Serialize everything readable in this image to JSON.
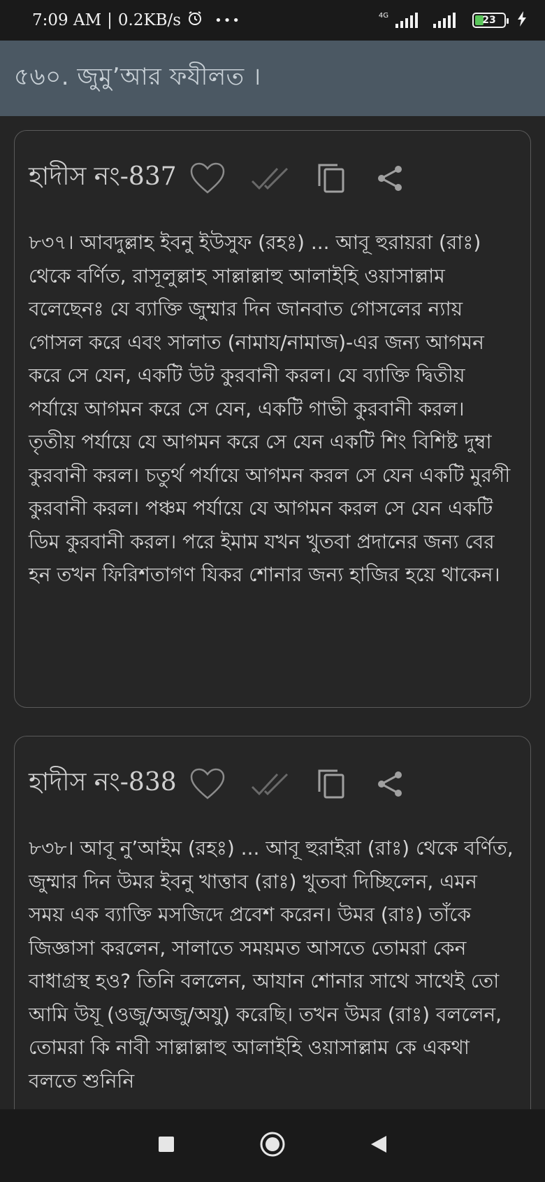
{
  "status": {
    "time": "7:09 AM",
    "speed": "0.2KB/s",
    "more": "•••",
    "network": "4G",
    "battery": "23",
    "icons": [
      "alarm-icon",
      "signal-icon",
      "battery-icon",
      "charging-icon"
    ]
  },
  "app_bar": {
    "title": "৫৬০. জুমু’আর ফযীলত ।"
  },
  "cards": [
    {
      "title": "হাদীস নং-837",
      "body": "৮৩৭। আবদুল্লাহ ইবনু ইউসুফ (রহঃ) ... আবূ হুরায়রা (রাঃ) থেকে বর্ণিত, রাসূলুল্লাহ সাল্লাল্লাহু আলাইহি ওয়াসাল্লাম বলেছেনঃ যে ব্যাক্তি জুম্মার দিন জানবাত গোসলের ন্যায় গোসল করে এবং সালাত (নামায/নামাজ)-এর জন্য আগমন করে সে যেন, একটি উট কুরবানী করল। যে ব্যাক্তি দ্বিতীয় পর্যায়ে আগমন করে সে যেন, একটি গাভী কুরবানী করল। তৃতীয় পর্যায়ে যে আগমন করে সে যেন একটি শিং বিশিষ্ট দুম্বা কুরবানী করল। চতুর্থ পর্যায়ে আগমন করল সে যেন একটি মুরগী কুরবানী করল। পঞ্চম পর্যায়ে যে আগমন করল সে যেন একটি ডিম কুরবানী করল। পরে ইমাম যখন খুতবা প্রদানের জন্য বের হন তখন ফিরিশতাগণ যিকর শোনার জন্য হাজির হয়ে থাকেন।"
    },
    {
      "title": "হাদীস নং-838",
      "body": "৮৩৮। আবূ নু’আইম (রহঃ) ... আবূ হুরাইরা (রাঃ) থেকে বর্ণিত, জুম্মার দিন উমর ইবনু খাত্তাব (রাঃ) খুতবা দিচ্ছিলেন, এমন সময় এক ব্যাক্তি মসজিদে প্রবেশ করেন। উমর (রাঃ) তাঁকে জিজ্ঞাসা করলেন, সালাতে সময়মত আসতে তোমরা কেন বাধাগ্রস্থ হও? তিনি বললেন, আযান শোনার সাথে সাথেই তো আমি উযূ (ওজু/অজু/অযু) করেছি। তখন উমর (রাঃ) বললেন, তোমরা কি নাবী সাল্লাল্লাহু আলাইহি ওয়াসাল্লাম কে একথা বলতে শুনিনি"
    }
  ],
  "nav": {
    "icons": [
      "recents-icon",
      "home-icon",
      "back-icon"
    ]
  },
  "colors": {
    "background": "#252525",
    "app_bar": "#4b5863",
    "card_border": "#5a5a5a",
    "text": "#d6d6d6",
    "battery_fill": "#5bc65b"
  }
}
